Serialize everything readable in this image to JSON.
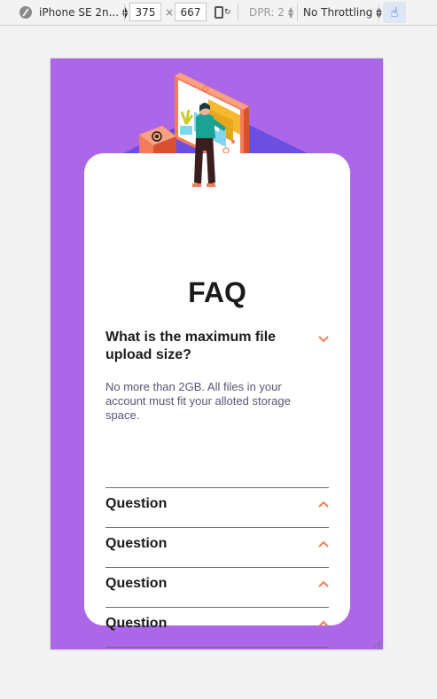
{
  "devtools": {
    "device": "iPhone SE 2n...",
    "width": "375",
    "height": "667",
    "dpr": "DPR: 2",
    "throttling": "No Throttling"
  },
  "faq": {
    "title": "FAQ",
    "items": [
      {
        "question": "What is the maximum file upload size?",
        "answer": "No more than 2GB. All files in your account must fit your alloted storage space.",
        "expanded": true
      },
      {
        "question": "Question",
        "expanded": false
      },
      {
        "question": "Question",
        "expanded": false
      },
      {
        "question": "Question",
        "expanded": false
      },
      {
        "question": "Question",
        "expanded": false
      }
    ]
  },
  "colors": {
    "background": "#ab67e8",
    "card": "#ffffff",
    "accent": "#f47c57",
    "text": "#1b1b1b",
    "answer": "#5a5470"
  }
}
